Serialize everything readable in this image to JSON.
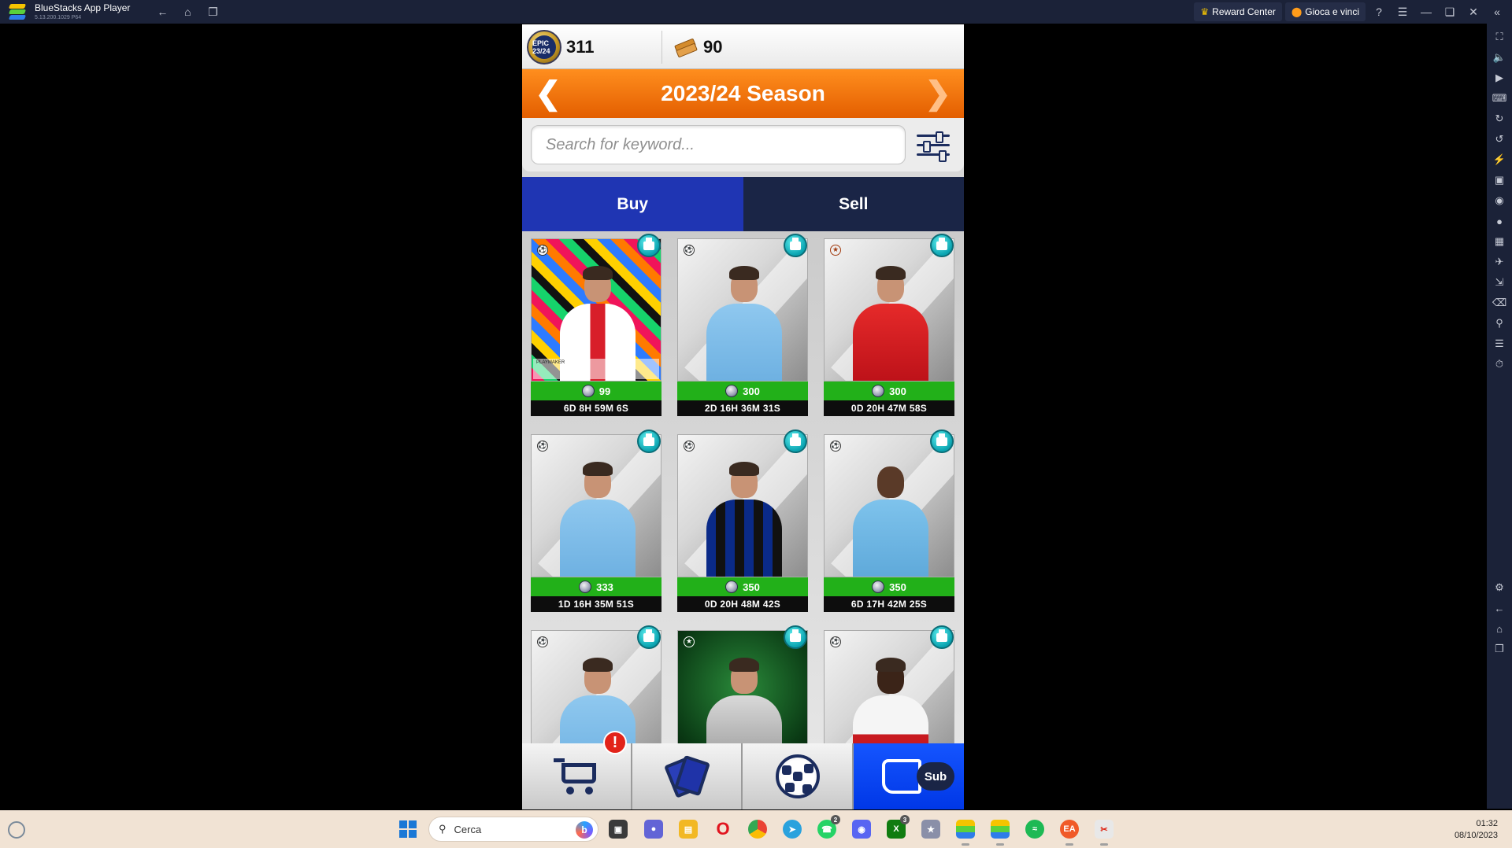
{
  "window": {
    "app_title": "BlueStacks App Player",
    "app_version": "5.13.200.1029 P64",
    "reward_center": "Reward Center",
    "play_and_win": "Gioca e vinci"
  },
  "game": {
    "coins": "311",
    "packs": "90",
    "coin_logo_text": "EPIC 23/24",
    "season_title": "2023/24 Season",
    "search_placeholder": "Search for keyword...",
    "tabs": {
      "buy": "Buy",
      "sell": "Sell"
    },
    "cards": [
      {
        "price": "99",
        "timer": "6D 8H 59M 6S",
        "style": "special",
        "kit": "bay",
        "competition": "ucl",
        "stat_label": "PLAYMAKER"
      },
      {
        "price": "300",
        "timer": "2D 16H 36M 31S",
        "style": "grey",
        "kit": "laz",
        "competition": "ucl"
      },
      {
        "price": "300",
        "timer": "0D 20H 47M 58S",
        "style": "grey",
        "kit": "liv",
        "competition": "uel"
      },
      {
        "price": "333",
        "timer": "1D 16H 35M 51S",
        "style": "grey",
        "kit": "laz",
        "competition": "ucl"
      },
      {
        "price": "350",
        "timer": "0D 20H 48M 42S",
        "style": "grey",
        "kit": "int",
        "competition": "ucl"
      },
      {
        "price": "350",
        "timer": "6D 17H 42M 25S",
        "style": "grey",
        "kit": "mci",
        "competition": "ucl"
      },
      {
        "price": "",
        "timer": "",
        "style": "grey",
        "kit": "laz",
        "competition": "ucl"
      },
      {
        "price": "",
        "timer": "",
        "style": "green",
        "kit": "gk",
        "competition": "uecl"
      },
      {
        "price": "",
        "timer": "",
        "style": "grey",
        "kit": "mil",
        "competition": "ucl"
      }
    ],
    "nav": {
      "alert_mark": "!",
      "sub_label": "Sub"
    }
  },
  "taskbar": {
    "search_label": "Cerca",
    "time": "01:32",
    "date": "08/10/2023",
    "whatsapp_badge": "2",
    "xbox_badge": "3"
  },
  "colors": {
    "season_bar": "#ff8e1e",
    "buy_tab": "#1f35b3",
    "sell_tab": "#1a2546",
    "price_strip": "#22b019",
    "nav_active": "#0037e6"
  }
}
